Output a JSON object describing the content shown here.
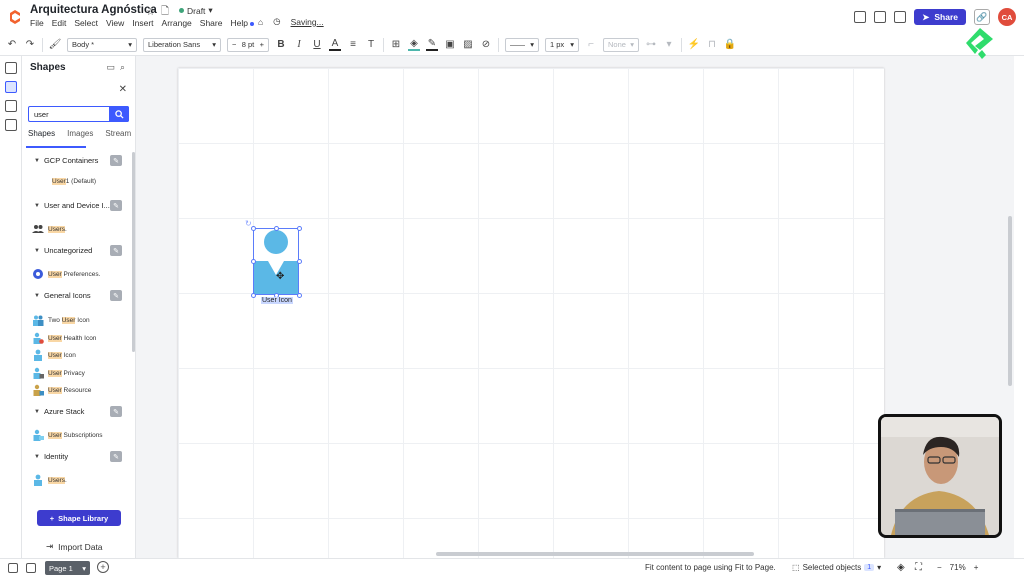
{
  "header": {
    "doc_title": "Arquitectura Agnóstica",
    "status": "Draft",
    "menu": [
      "File",
      "Edit",
      "Select",
      "View",
      "Insert",
      "Arrange",
      "Share",
      "Help"
    ],
    "saving": "Saving...",
    "share_label": "Share",
    "avatar_initials": "CA"
  },
  "toolbar": {
    "style": "Body *",
    "font": "Liberation Sans",
    "font_size": "8 pt",
    "minus": "−",
    "plus": "+",
    "bold": "B",
    "italic": "I",
    "underline": "U",
    "line_width": "1 px",
    "arrow_style": "None"
  },
  "panel": {
    "title": "Shapes",
    "search_value": "user",
    "tabs": [
      "Shapes",
      "Images",
      "Stream"
    ],
    "groups": [
      {
        "name": "GCP Containers",
        "items": [
          {
            "hl": "User",
            "rest": " 1 (Default)"
          }
        ]
      },
      {
        "name": "User and Device I...",
        "items": [
          {
            "hl": "Users",
            "rest": "."
          }
        ]
      },
      {
        "name": "Uncategorized",
        "items": [
          {
            "hl": "User",
            "rest": " Preferences."
          }
        ]
      },
      {
        "name": "General Icons",
        "items": [
          {
            "pre": "Two ",
            "hl": "User",
            "rest": " Icon"
          },
          {
            "hl": "User",
            "rest": " Health Icon"
          },
          {
            "hl": "User",
            "rest": " Icon"
          },
          {
            "hl": "User",
            "rest": " Privacy"
          },
          {
            "hl": "User",
            "rest": " Resource"
          }
        ]
      },
      {
        "name": "Azure Stack",
        "items": [
          {
            "hl": "User",
            "rest": " Subscriptions"
          }
        ]
      },
      {
        "name": "Identity",
        "items": [
          {
            "hl": "Users",
            "rest": "."
          }
        ]
      }
    ],
    "shape_library_label": "Shape Library",
    "import_data_label": "Import Data"
  },
  "canvas": {
    "shape_label": "User Icon",
    "shape_color": "#5bb8e6"
  },
  "bottom": {
    "page_tab": "Page 1",
    "status_message": "Fit content to page using Fit to Page.",
    "selected_label": "Selected objects",
    "selected_count": "1",
    "zoom": "71%",
    "zoom_minus": "−",
    "zoom_plus": "+"
  }
}
